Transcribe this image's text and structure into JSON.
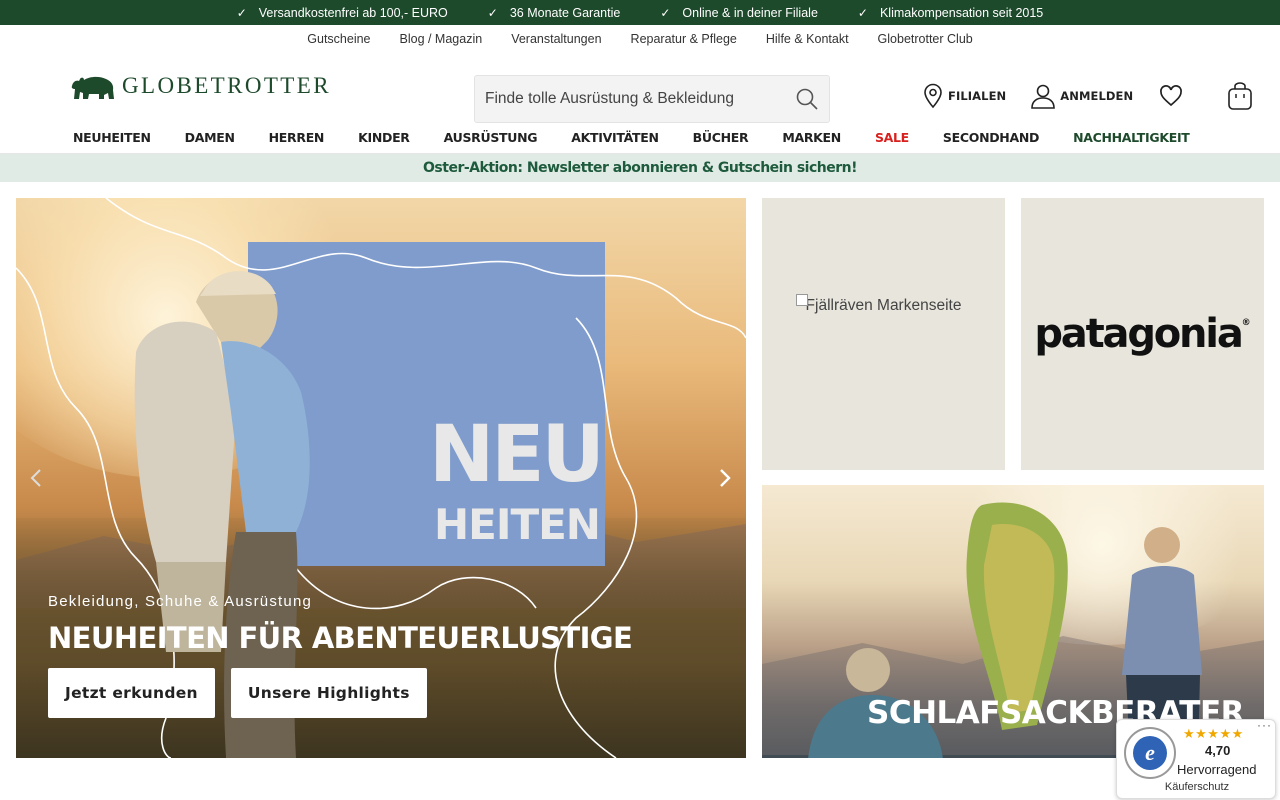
{
  "usp": [
    {
      "check": "✓",
      "text": "Versandkostenfrei ab 100,- EURO"
    },
    {
      "check": "✓",
      "text": "36 Monate Garantie"
    },
    {
      "check": "✓",
      "text": "Online & in deiner Filiale"
    },
    {
      "check": "✓",
      "text": "Klimakompensation seit 2015"
    }
  ],
  "service_nav": [
    "Gutscheine",
    "Blog / Magazin",
    "Veranstaltungen",
    "Reparatur & Pflege",
    "Hilfe & Kontakt",
    "Globetrotter Club"
  ],
  "header": {
    "logo_text": "GLOBETROTTER",
    "search_placeholder": "Finde tolle Ausrüstung & Bekleidung",
    "filialen_label": "FILIALEN",
    "login_label": "ANMELDEN"
  },
  "main_nav": [
    "NEUHEITEN",
    "DAMEN",
    "HERREN",
    "KINDER",
    "AUSRÜSTUNG",
    "AKTIVITÄTEN",
    "BÜCHER",
    "MARKEN",
    "SALE",
    "SECONDHAND",
    "NACHHALTIGKEIT"
  ],
  "promo": "Oster-Aktion: Newsletter abonnieren & Gutschein sichern!",
  "hero": {
    "overlay_neu": "NEU",
    "overlay_heiten": "HEITEN",
    "subtitle": "Bekleidung, Schuhe & Ausrüstung",
    "title": "NEUHEITEN FÜR ABENTEUERLUSTIGE",
    "btn_primary": "Jetzt erkunden",
    "btn_secondary": "Unsere Highlights"
  },
  "tiles": {
    "fjallraven_alt": "Fjällräven Markenseite",
    "patagonia_logo": "patagonia",
    "patagonia_reg": "®",
    "schlafsack_title": "SCHLAFSACKBERATER"
  },
  "trusted_shops": {
    "stars": "★★★★★",
    "rating": "4,70",
    "label": "Hervorragend",
    "footer": "Käuferschutz",
    "more": "···"
  },
  "colors": {
    "brand_green": "#1e4a2c",
    "sale_red": "#d8201e",
    "promo_bg": "#e1ebe6"
  }
}
